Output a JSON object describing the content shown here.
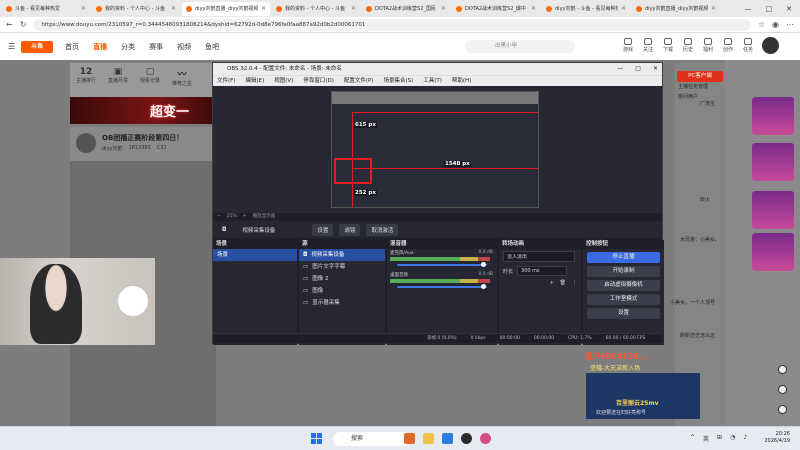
{
  "browser": {
    "tabs": [
      {
        "label": "斗鱼 - 看见每种热爱",
        "active": false
      },
      {
        "label": "我的资料 - 个人中心 - 斗鱼",
        "active": false
      },
      {
        "label": "diyy刘鹤直播_diyy刘鹤视频",
        "active": true
      },
      {
        "label": "我的资料 - 个人中心 - 斗鱼",
        "active": false
      },
      {
        "label": "DOTA2战术训练营S2_国民",
        "active": false
      },
      {
        "label": "DOTA2战术训练营S2_爆中",
        "active": false
      },
      {
        "label": "diyy刘鹤 - 斗鱼 - 看见每种热",
        "active": false
      },
      {
        "label": "diyy刘鹤直播_diyy刘鹤视频",
        "active": false
      }
    ],
    "url": "https://www.douyu.com/2310597_r=0.34445460931808214&dyshid=62792d-0d8e796fa0faa887a92d0b2d00061701"
  },
  "site": {
    "nav": [
      "首页",
      "直播",
      "分类",
      "赛事",
      "视频",
      "鱼吧"
    ],
    "nav_current": "直播",
    "search_placeholder": "出黑小甲",
    "header_icons": [
      "游戏",
      "关注",
      "下载",
      "历史",
      "福利",
      "创作",
      "任务"
    ],
    "stats": [
      {
        "value": "12",
        "label": "主播排行"
      },
      {
        "value": "",
        "label": "直播月票"
      },
      {
        "value": "",
        "label": "观看记录"
      },
      {
        "value": "",
        "label": "推荐之星"
      }
    ],
    "banner_text": "超变一",
    "room_title": "OB团播正赛阶段第四日！",
    "room_meta": [
      "diyy刘鹤",
      "1813385",
      "C32"
    ],
    "pc_button": "PC客户端",
    "chat": [
      "主播任务管理",
      "房间用户",
      "厂流主",
      "玩火",
      "大兄弟：小美女。",
      "小美女。一个人顶号",
      "刷新茫茫怎么这",
      "用户5860158...",
      "坚蛾-大兄弟新入场"
    ],
    "promo_title": "百里丽云25mv",
    "promo_sub": "欢迎要送在妇好亮称号"
  },
  "obs": {
    "title": "OBS 32.0.4 - 配置文件: 未命名 - 场景: 未命名",
    "menu": [
      "文件(F)",
      "编辑(E)",
      "视图(V)",
      "停靠窗口(D)",
      "配置文件(P)",
      "场景集合(S)",
      "工具(T)",
      "帮助(H)"
    ],
    "preview_labels": {
      "size1": "615 px",
      "size2": "1548 px",
      "size3": "252 px"
    },
    "zoom": "25%",
    "zoom_hint": "播放显示器",
    "source_name": "视频采集设备",
    "toolbar": [
      "设置",
      "滤镜",
      "取消激活"
    ],
    "scenes": {
      "title": "场景",
      "items": [
        "场景"
      ]
    },
    "sources": {
      "title": "源",
      "items": [
        "视频采集设备",
        "图片文字字幕",
        "图像 2",
        "图像",
        "显示器采集"
      ]
    },
    "mixer": {
      "title": "混音器",
      "channels": [
        {
          "name": "麦克风/Aux",
          "db": "0.0 dB"
        },
        {
          "name": "桌面音频",
          "db": "0.0 dB"
        }
      ]
    },
    "transitions": {
      "title": "转场动画",
      "type": "淡入淡出",
      "duration_label": "时长",
      "duration": "300 ms"
    },
    "controls": {
      "title": "控制按钮",
      "buttons": [
        "停止直播",
        "开始录制",
        "启动虚拟摄像机",
        "工作室模式",
        "设置"
      ]
    },
    "status": {
      "frames": "丢帧 0 (0.0%)",
      "kbps": "0 kbps",
      "rec": "00:00:00",
      "time": "00:00:00",
      "cpu": "CPU: 1.7%",
      "fps": "60.00 / 60.00 FPS"
    }
  },
  "taskbar": {
    "search_placeholder": "搜索",
    "ime": "英",
    "time": "20:26",
    "date": "2026/4/19"
  },
  "colors": {
    "brand": "#ff5a00",
    "obs_accent": "#3a6be0",
    "live_red": "#e0321a"
  }
}
